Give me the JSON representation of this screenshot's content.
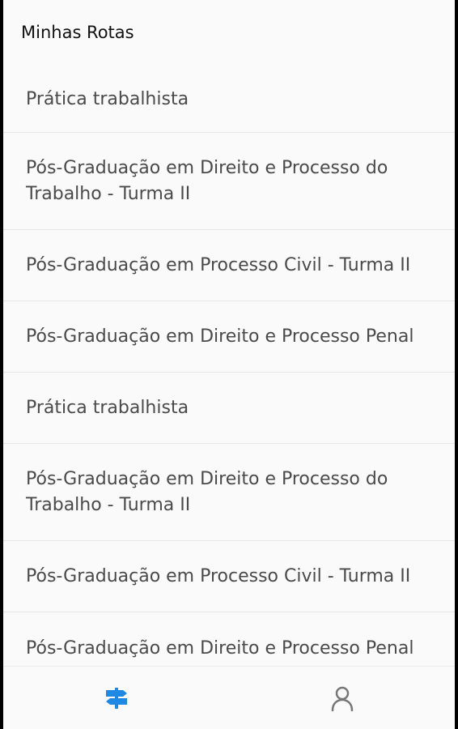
{
  "header": {
    "title": "Minhas Rotas"
  },
  "routes": [
    {
      "label": "Prática trabalhista"
    },
    {
      "label": "Pós-Graduação em Direito e Processo do Trabalho - Turma II"
    },
    {
      "label": "Pós-Graduação em Processo Civil - Turma II"
    },
    {
      "label": "Pós-Graduação em Direito e Processo Penal"
    },
    {
      "label": "Prática trabalhista"
    },
    {
      "label": "Pós-Graduação em Direito e Processo do Trabalho - Turma II"
    },
    {
      "label": "Pós-Graduação em Processo Civil - Turma II"
    },
    {
      "label": "Pós-Graduação em Direito e Processo Penal"
    }
  ],
  "tabbar": {
    "routes_tab_icon": "signpost-icon",
    "profile_tab_icon": "user-icon",
    "active_color": "#1e88e5",
    "inactive_color": "#777777"
  }
}
